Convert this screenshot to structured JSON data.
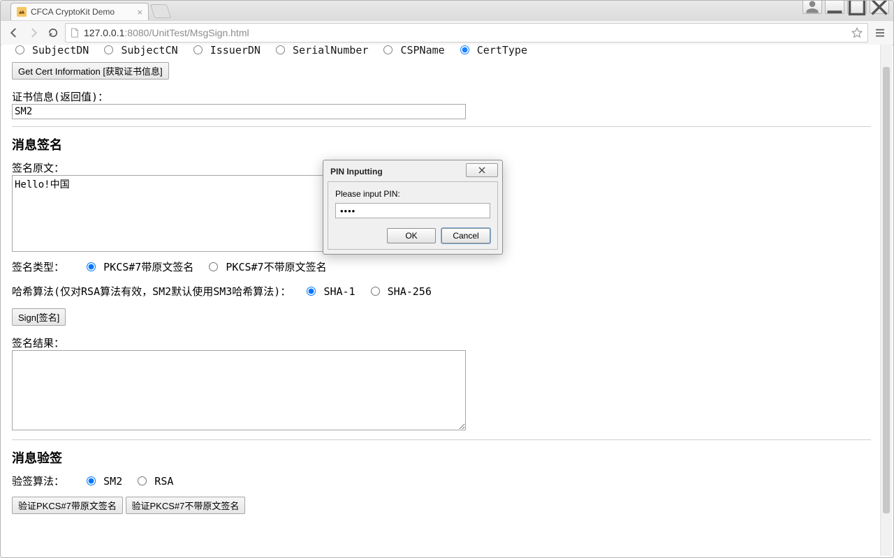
{
  "window": {
    "tab_title": "CFCA CryptoKit Demo",
    "url_host": "127.0.0.1",
    "url_port": ":8080",
    "url_path": "/UnitTest/MsgSign.html"
  },
  "cert_info_radios": {
    "subject_dn": "SubjectDN",
    "subject_cn": "SubjectCN",
    "issuer_dn": "IssuerDN",
    "serial_number": "SerialNumber",
    "csp_name": "CSPName",
    "cert_type": "CertType"
  },
  "buttons": {
    "get_cert_info": "Get Cert Information [获取证书信息]",
    "sign": "Sign[签名]",
    "verify_p7_attached": "验证PKCS#7带原文签名",
    "verify_p7_detached": "验证PKCS#7不带原文签名"
  },
  "labels": {
    "cert_info_return": "证书信息(返回值)：",
    "msg_sign_header": "消息签名",
    "sign_source": "签名原文：",
    "sign_type": "签名类型：",
    "hash_algo": "哈希算法(仅对RSA算法有效，SM2默认使用SM3哈希算法)：",
    "sign_result": "签名结果：",
    "msg_verify_header": "消息验签",
    "verify_algo": "验签算法："
  },
  "values": {
    "cert_info_value": "SM2",
    "sign_source_value": "Hello!中国",
    "sign_result_value": ""
  },
  "sign_type_options": {
    "attached": "PKCS#7带原文签名",
    "detached": "PKCS#7不带原文签名"
  },
  "hash_options": {
    "sha1": "SHA-1",
    "sha256": "SHA-256"
  },
  "verify_algo_options": {
    "sm2": "SM2",
    "rsa": "RSA"
  },
  "pin_dialog": {
    "title": "PIN Inputting",
    "prompt": "Please input PIN:",
    "value": "••••",
    "ok": "OK",
    "cancel": "Cancel"
  }
}
